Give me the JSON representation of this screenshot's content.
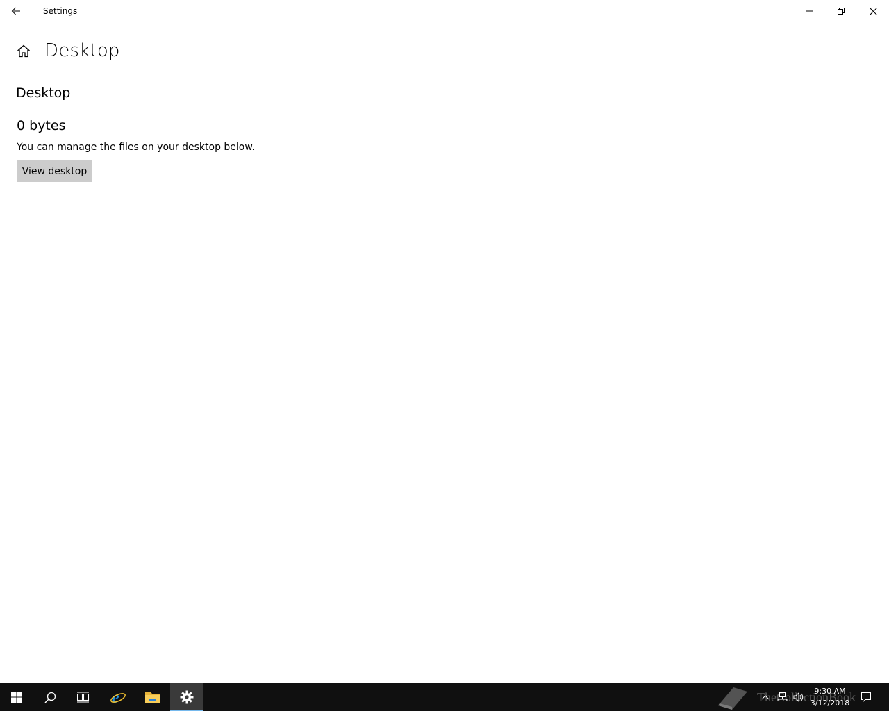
{
  "titlebar": {
    "app_title": "Settings",
    "back_icon": "back-arrow-icon",
    "minimize_icon": "minimize-icon",
    "restore_icon": "restore-icon",
    "close_icon": "close-icon"
  },
  "header": {
    "home_icon": "home-icon",
    "title": "Desktop"
  },
  "content": {
    "section_title": "Desktop",
    "size": "0 bytes",
    "description": "You can manage the files on your desktop below.",
    "view_button_label": "View desktop"
  },
  "taskbar": {
    "items": [
      "windows-start-icon",
      "search-icon",
      "task-view-icon",
      "internet-explorer-icon",
      "file-explorer-icon",
      "settings-gear-icon"
    ],
    "active_item": "settings-gear-icon",
    "watermark": "TheCollectionBook",
    "tray_icons": [
      "chevron-up-icon",
      "network-icon",
      "volume-icon",
      "notification-icon"
    ],
    "time": "9:30 AM",
    "date": "3/12/2018"
  },
  "colors": {
    "taskbar_bg": "#101010",
    "active_accent": "#76b9ed",
    "button_bg": "#cccccc"
  }
}
